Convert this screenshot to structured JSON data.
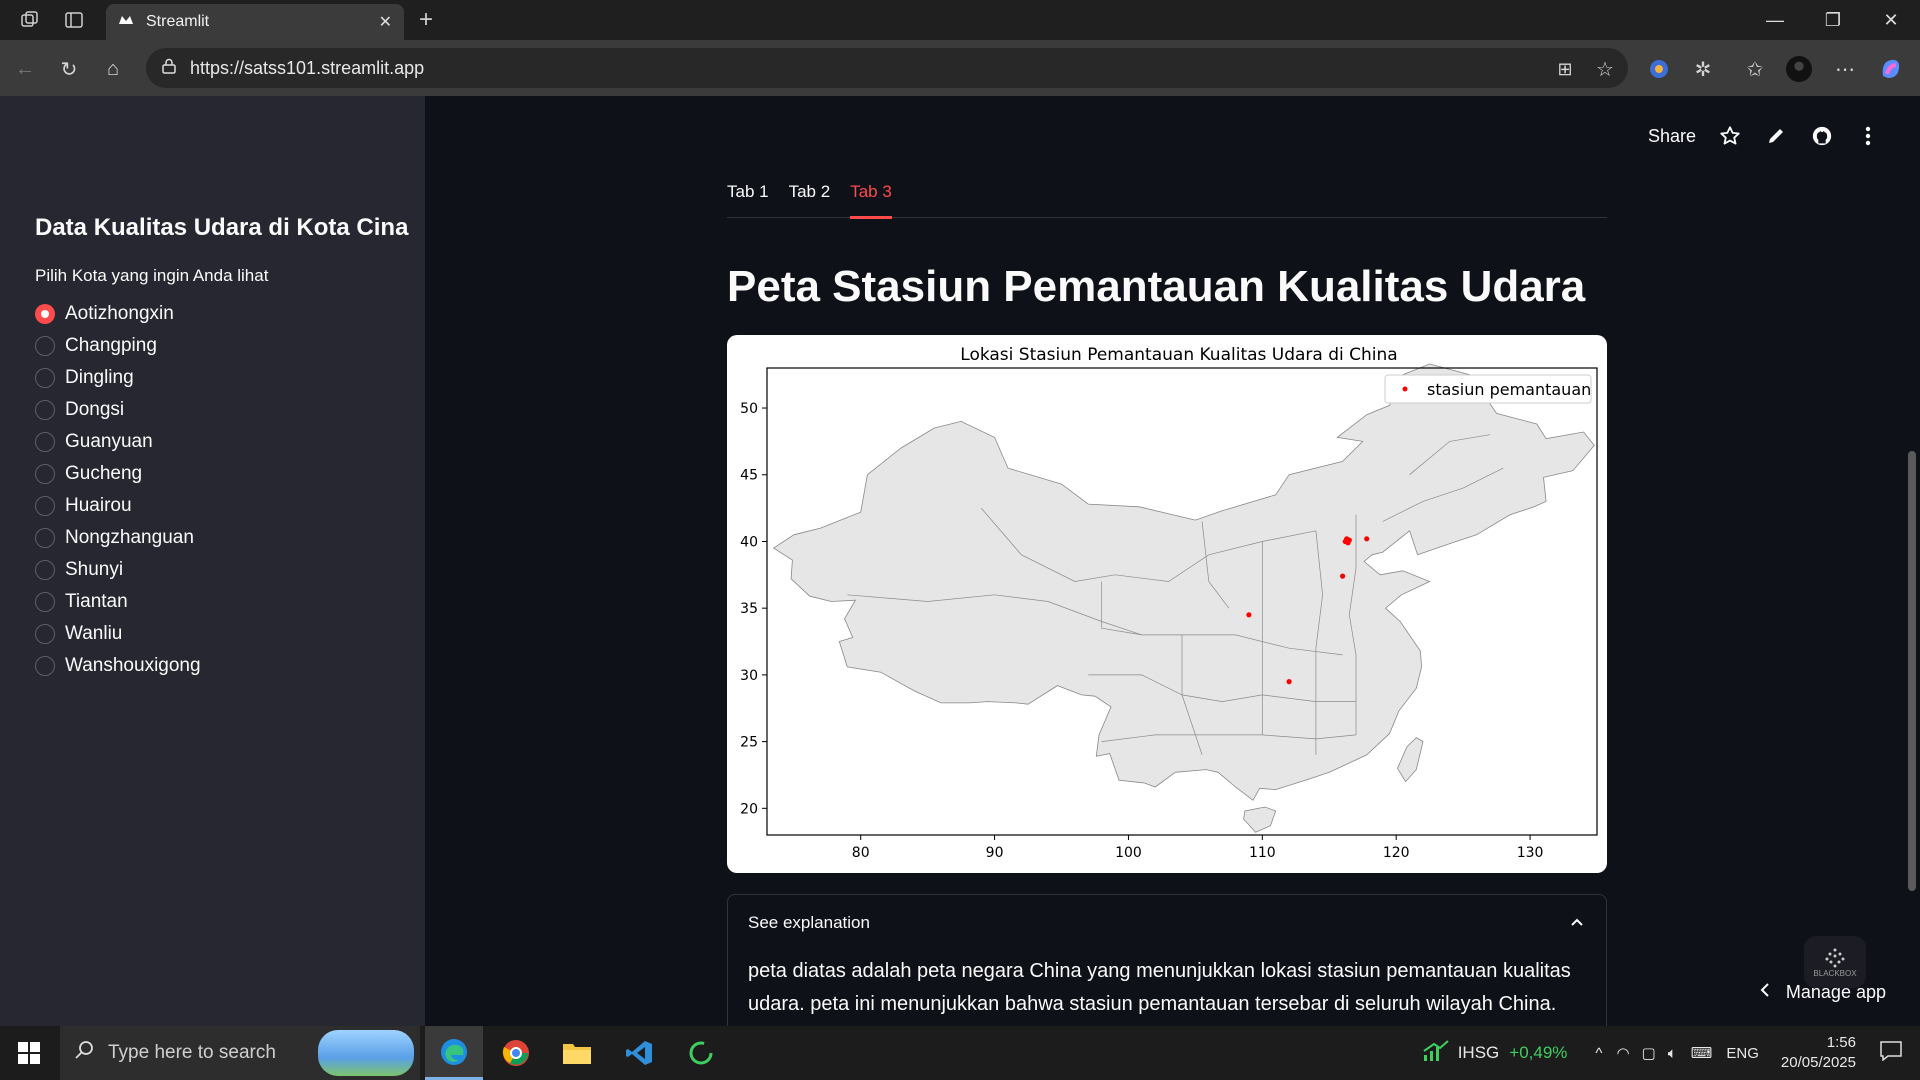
{
  "browser": {
    "tab_title": "Streamlit",
    "url": "https://satss101.streamlit.app"
  },
  "sidebar": {
    "title": "Data Kualitas Udara di Kota Cina",
    "radio_label": "Pilih Kota yang ingin Anda lihat",
    "options": [
      "Aotizhongxin",
      "Changping",
      "Dingling",
      "Dongsi",
      "Guanyuan",
      "Gucheng",
      "Huairou",
      "Nongzhanguan",
      "Shunyi",
      "Tiantan",
      "Wanliu",
      "Wanshouxigong"
    ],
    "selected": "Aotizhongxin"
  },
  "toolbar": {
    "share_label": "Share"
  },
  "tabs": [
    "Tab 1",
    "Tab 2",
    "Tab 3"
  ],
  "active_tab": "Tab 3",
  "page": {
    "title": "Peta Stasiun Pemantauan Kualitas Udara"
  },
  "chart_data": {
    "type": "scatter",
    "title": "Lokasi Stasiun Pemantauan Kualitas Udara di China",
    "xlabel": "",
    "ylabel": "",
    "xlim": [
      73,
      135
    ],
    "ylim": [
      18,
      53
    ],
    "xticks": [
      80,
      90,
      100,
      110,
      120,
      130
    ],
    "yticks": [
      20,
      25,
      30,
      35,
      40,
      45,
      50
    ],
    "legend_position": "top-right",
    "series": [
      {
        "name": "stasiun pemantauan",
        "color": "#ff0000",
        "points": [
          [
            116.2,
            40.0
          ],
          [
            116.3,
            40.2
          ],
          [
            116.4,
            39.9
          ],
          [
            116.5,
            40.1
          ],
          [
            117.8,
            40.2
          ],
          [
            116.0,
            37.4
          ],
          [
            109.0,
            34.5
          ],
          [
            112.0,
            29.5
          ]
        ]
      }
    ],
    "background_map": "China provinces outline"
  },
  "expander": {
    "label": "See explanation",
    "text": "peta diatas adalah peta negara China yang menunjukkan lokasi stasiun pemantauan kualitas udara. peta ini menunjukkan bahwa stasiun pemantauan tersebar di seluruh wilayah China. namun tidak"
  },
  "footer": {
    "manage_app": "Manage app",
    "badge": "BLACKBOX"
  },
  "taskbar": {
    "search_placeholder": "Type here to search",
    "ticker": "IHSG",
    "ticker_change": "+0,49%",
    "language": "ENG",
    "time": "1:56",
    "date": "20/05/2025"
  }
}
